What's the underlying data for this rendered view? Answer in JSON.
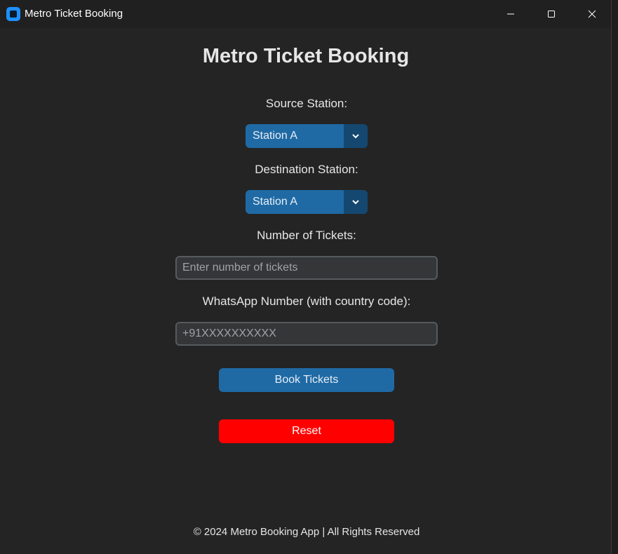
{
  "window": {
    "title": "Metro Ticket Booking"
  },
  "heading": "Metro Ticket Booking",
  "source": {
    "label": "Source Station:",
    "selected": "Station A"
  },
  "destination": {
    "label": "Destination Station:",
    "selected": "Station A"
  },
  "tickets": {
    "label": "Number of Tickets:",
    "value": "",
    "placeholder": "Enter number of tickets"
  },
  "whatsapp": {
    "label": "WhatsApp Number (with country code):",
    "value": "",
    "placeholder": "+91XXXXXXXXXX"
  },
  "buttons": {
    "book": "Book Tickets",
    "reset": "Reset"
  },
  "footer": "© 2024 Metro Booking App | All Rights Reserved",
  "colors": {
    "accent": "#1f6aa5",
    "accent_dark": "#144870",
    "reset": "#ff0000",
    "background": "#242424",
    "entry_bg": "#343638"
  }
}
